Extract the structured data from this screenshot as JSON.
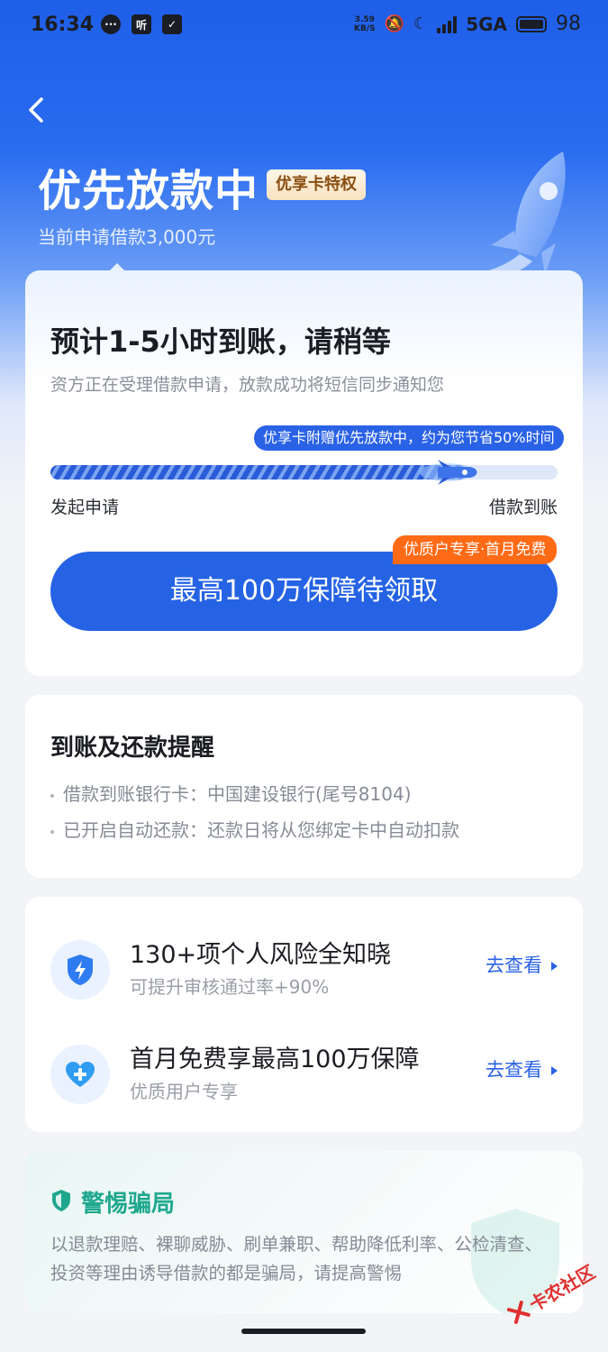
{
  "status_bar": {
    "time": "16:34",
    "network_speed_value": "3.59",
    "network_speed_unit": "KB/S",
    "network": "5GA",
    "battery": "98"
  },
  "hero": {
    "title": "优先放款中",
    "badge": "优享卡特权",
    "subtitle": "当前申请借款3,000元"
  },
  "main_card": {
    "heading": "预计1-5小时到账，请稍等",
    "description": "资方正在受理借款申请，放款成功将短信同步通知您",
    "tip": "优享卡附赠优先放款中，约为您节省50%时间",
    "progress": 0.82,
    "start_label": "发起申请",
    "end_label": "借款到账",
    "cta_label": "最高100万保障待领取",
    "cta_tag": "优质户专享·首月免费"
  },
  "reminder": {
    "title": "到账及还款提醒",
    "items": [
      "借款到账银行卡：中国建设银行(尾号8104)",
      "已开启自动还款：还款日将从您绑定卡中自动扣款"
    ]
  },
  "features": [
    {
      "title": "130+项个人风险全知晓",
      "subtitle": "可提升审核通过率+90%",
      "link": "去查看",
      "icon": "shield-bolt-icon"
    },
    {
      "title": "首月免费享最高100万保障",
      "subtitle": "优质用户专享",
      "link": "去查看",
      "icon": "heart-plus-icon"
    }
  ],
  "warning": {
    "title": "警惕骗局",
    "text": "以退款理赔、裸聊威胁、刷单兼职、帮助降低利率、公检清查、投资等理由诱导借款的都是骗局，请提高警惕"
  },
  "watermark": "卡农社区",
  "colors": {
    "primary": "#2563e4",
    "accent_orange": "#ff6a16",
    "warn_green": "#1fa88e"
  }
}
